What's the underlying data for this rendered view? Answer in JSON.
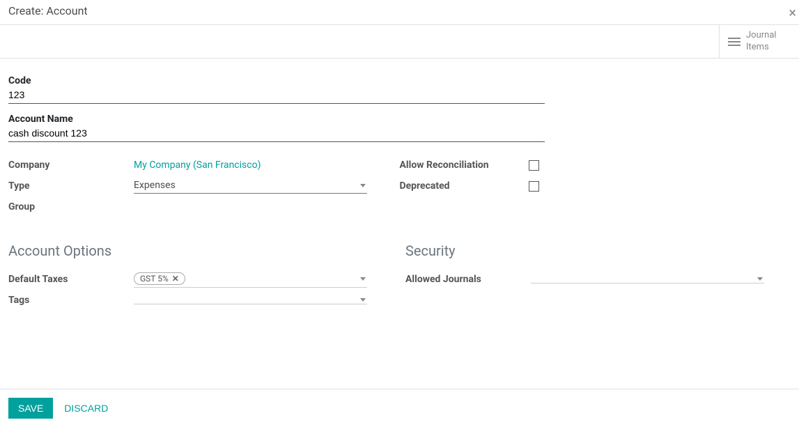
{
  "header": {
    "title": "Create: Account"
  },
  "stat": {
    "line1": "Journal",
    "line2": "Items"
  },
  "form": {
    "code": {
      "label": "Code",
      "value": "123"
    },
    "name": {
      "label": "Account Name",
      "value": "cash discount 123"
    },
    "company": {
      "label": "Company",
      "value": "My Company (San Francisco)"
    },
    "type": {
      "label": "Type",
      "value": "Expenses"
    },
    "group": {
      "label": "Group"
    },
    "allow_reconciliation": {
      "label": "Allow Reconciliation",
      "checked": false
    },
    "deprecated": {
      "label": "Deprecated",
      "checked": false
    }
  },
  "sections": {
    "account_options": {
      "title": "Account Options",
      "default_taxes": {
        "label": "Default Taxes",
        "tags": [
          "GST 5%"
        ]
      },
      "tags": {
        "label": "Tags"
      }
    },
    "security": {
      "title": "Security",
      "allowed_journals": {
        "label": "Allowed Journals"
      }
    }
  },
  "footer": {
    "save": "SAVE",
    "discard": "DISCARD"
  }
}
